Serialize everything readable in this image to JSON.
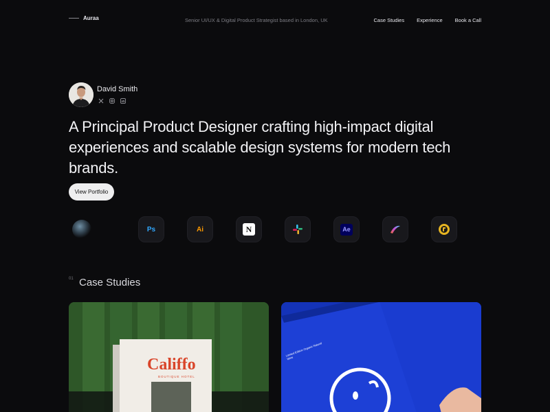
{
  "header": {
    "brand": "Auraa",
    "tagline": "Senior UI/UX & Digital Product Strategist based in London, UK",
    "nav": [
      "Case Studies",
      "Experience",
      "Book a Call"
    ]
  },
  "profile": {
    "name": "David Smith",
    "socials": [
      "x-icon",
      "instagram-icon",
      "linkedin-icon"
    ]
  },
  "hero": {
    "headline": "A Principal Product Designer crafting high-impact digital experiences and scalable design systems for modern tech brands.",
    "cta": "View Portfolio"
  },
  "tools": [
    {
      "icon": "globe-icon",
      "label": ""
    },
    {
      "icon": "photoshop-icon",
      "label": "Ps",
      "color": "#31a8ff"
    },
    {
      "icon": "illustrator-icon",
      "label": "Ai",
      "color": "#ff9a00"
    },
    {
      "icon": "notion-icon",
      "label": "N",
      "color": "#ffffff"
    },
    {
      "icon": "slack-icon",
      "label": ""
    },
    {
      "icon": "after-effects-icon",
      "label": "Ae",
      "color": "#9999ff"
    },
    {
      "icon": "procreate-icon",
      "label": ""
    },
    {
      "icon": "rive-icon",
      "label": ""
    }
  ],
  "case_studies": {
    "number": "01",
    "title": "Case Studies",
    "cards": [
      {
        "book_title": "Califfo",
        "book_subtitle": "BOUTIQUE HOTEL"
      },
      {
        "brand_text": "Limited Edition Organic Natural Wine"
      }
    ]
  },
  "colors": {
    "background": "#0b0b0d",
    "card_green": "#2f5a2a",
    "card_blue": "#1433b8",
    "califfo_red": "#d9452a"
  }
}
